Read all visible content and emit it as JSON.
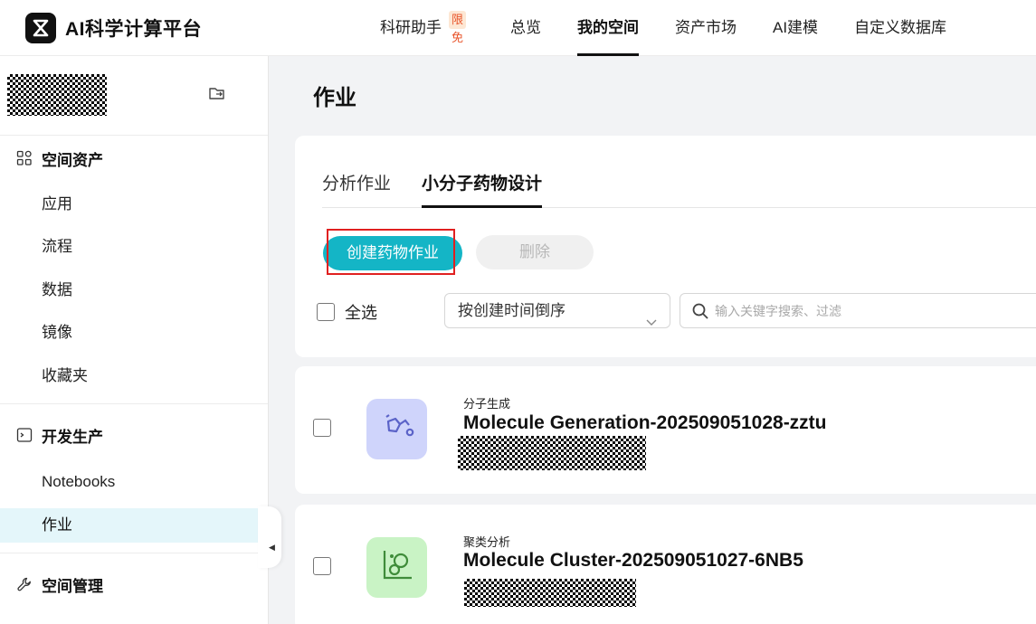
{
  "header": {
    "brand": "AI科学计算平台",
    "nav": [
      {
        "label": "科研助手"
      },
      {
        "label": "总览"
      },
      {
        "label": "我的空间"
      },
      {
        "label": "资产市场"
      },
      {
        "label": "AI建模"
      },
      {
        "label": "自定义数据库"
      }
    ],
    "assistant_badge": "限免",
    "active_nav": "我的空间"
  },
  "sidebar": {
    "sections": [
      {
        "title": "空间资产",
        "icon": "grid-icon",
        "items": [
          "应用",
          "流程",
          "数据",
          "镜像",
          "收藏夹"
        ]
      },
      {
        "title": "开发生产",
        "icon": "code-icon",
        "items": [
          "Notebooks",
          "作业"
        ]
      },
      {
        "title": "空间管理",
        "icon": "wrench-icon",
        "items": []
      }
    ],
    "active_item": "作业"
  },
  "main": {
    "title": "作业",
    "tabs": [
      "分析作业",
      "小分子药物设计"
    ],
    "active_tab": "小分子药物设计",
    "create_button": "创建药物作业",
    "delete_button": "删除",
    "select_all": "全选",
    "sort_value": "按创建时间倒序",
    "search_placeholder": "输入关键字搜索、过滤"
  },
  "jobs": [
    {
      "type": "分子生成",
      "name": "Molecule Generation-202509051028-zztu",
      "icon": "molecule-generation-icon",
      "icon_bg": "#cfd4fb"
    },
    {
      "type": "聚类分析",
      "name": "Molecule Cluster-202509051027-6NB5",
      "icon": "cluster-chart-icon",
      "icon_bg": "#c9f3c5"
    }
  ],
  "colors": {
    "accent": "#14b5c6",
    "highlight_border": "#e02020",
    "active_sidebar_bg": "#e4f6fa",
    "badge": "#e8542a"
  }
}
